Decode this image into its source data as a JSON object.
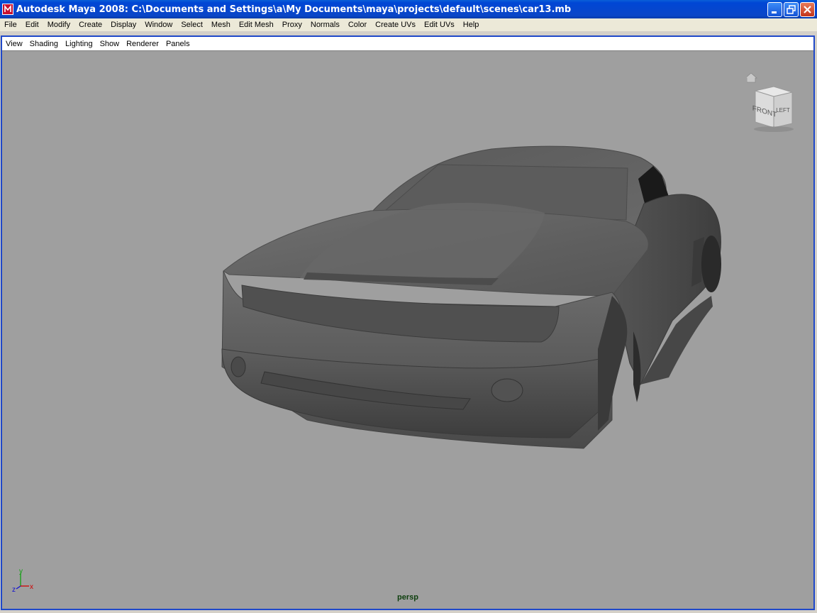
{
  "window": {
    "title": "Autodesk Maya 2008: C:\\Documents and Settings\\a\\My Documents\\maya\\projects\\default\\scenes\\car13.mb",
    "buttons": [
      "minimize-icon",
      "restore-icon",
      "close-icon"
    ]
  },
  "menubar": {
    "items": [
      "File",
      "Edit",
      "Modify",
      "Create",
      "Display",
      "Window",
      "Select",
      "Mesh",
      "Edit Mesh",
      "Proxy",
      "Normals",
      "Color",
      "Create UVs",
      "Edit UVs",
      "Help"
    ]
  },
  "panel": {
    "menu": [
      "View",
      "Shading",
      "Lighting",
      "Show",
      "Renderer",
      "Panels"
    ],
    "camera": "persp",
    "viewcube": {
      "front": "FRONT",
      "left": "LEFT",
      "home_icon": "home-icon"
    },
    "axis": {
      "x": "x",
      "y": "y",
      "z": "z"
    }
  },
  "colors": {
    "titlebar": "#0046d5",
    "viewport_bg": "#9f9f9f",
    "panel_border": "#1f48c9",
    "axis_x": "#d00000",
    "axis_y": "#10a010",
    "axis_z": "#1010d0"
  }
}
